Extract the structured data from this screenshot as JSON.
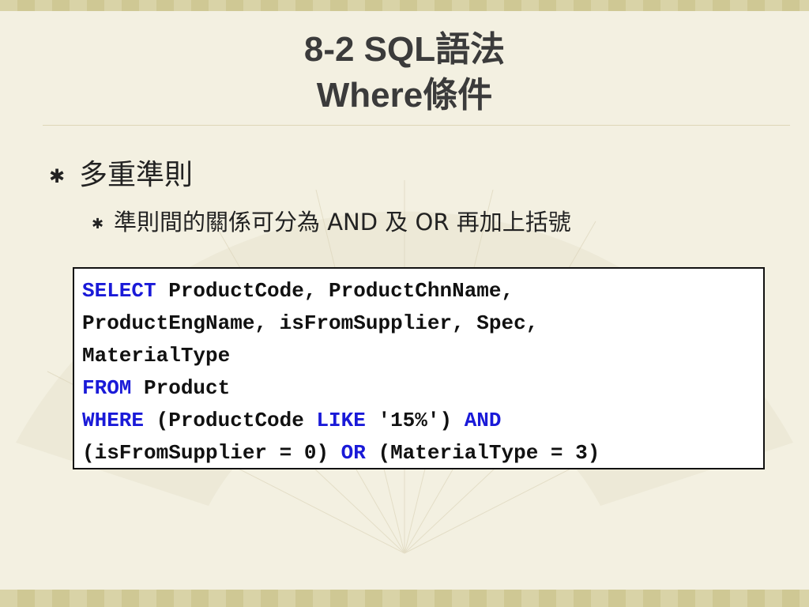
{
  "slide": {
    "title_line1": "8-2 SQL語法",
    "title_line2": "Where條件"
  },
  "bullets": {
    "level1": {
      "marker": "✱",
      "text": "多重準則"
    },
    "level2": {
      "marker": "✱",
      "text": "準則間的關係可分為 AND 及 OR 再加上括號"
    }
  },
  "code": {
    "line1_kw": "SELECT",
    "line1_rest": " ProductCode, ProductChnName,",
    "line2": "ProductEngName, isFromSupplier, Spec,",
    "line3": "MaterialType",
    "line4_kw": "FROM",
    "line4_rest": " Product",
    "line5_kw": "WHERE",
    "line5_a": " (ProductCode ",
    "line5_kw2": "LIKE",
    "line5_b": " '15%') ",
    "line5_kw3": "AND",
    "line6_a": "(isFromSupplier = 0) ",
    "line6_kw": "OR",
    "line6_b": " (MaterialType = 3)"
  },
  "colors": {
    "background": "#f3f0e1",
    "keyword": "#1a1ad8",
    "title": "#3b3b3b"
  }
}
